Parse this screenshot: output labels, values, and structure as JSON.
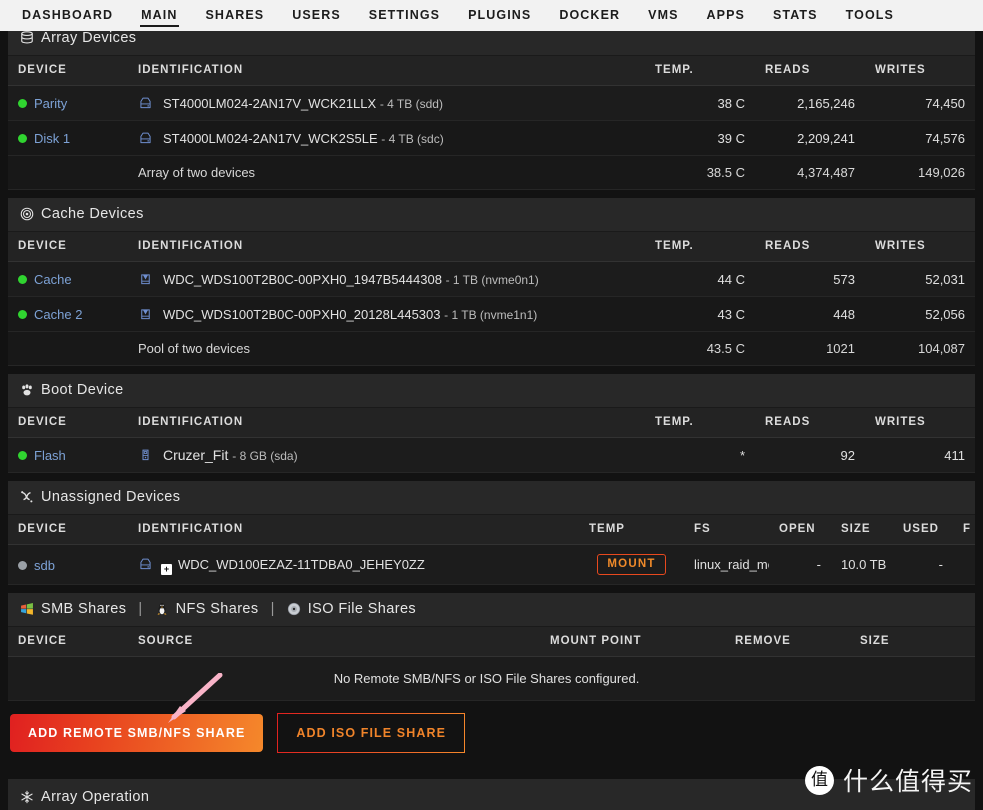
{
  "nav": {
    "items": [
      {
        "label": "DASHBOARD",
        "active": false
      },
      {
        "label": "MAIN",
        "active": true
      },
      {
        "label": "SHARES",
        "active": false
      },
      {
        "label": "USERS",
        "active": false
      },
      {
        "label": "SETTINGS",
        "active": false
      },
      {
        "label": "PLUGINS",
        "active": false
      },
      {
        "label": "DOCKER",
        "active": false
      },
      {
        "label": "VMS",
        "active": false
      },
      {
        "label": "APPS",
        "active": false
      },
      {
        "label": "STATS",
        "active": false
      },
      {
        "label": "TOOLS",
        "active": false
      }
    ]
  },
  "array_devices": {
    "title": "Array Devices",
    "icon": "database-stack-icon",
    "columns": [
      "DEVICE",
      "IDENTIFICATION",
      "TEMP.",
      "READS",
      "WRITES"
    ],
    "rows": [
      {
        "device": "Parity",
        "status_color": "#30d430",
        "icon": "hard-disk-icon",
        "identification": "ST4000LM024-2AN17V_WCK21LLX",
        "ident_suffix": "- 4 TB (sdd)",
        "temp": "38 C",
        "reads": "2,165,246",
        "writes": "74,450"
      },
      {
        "device": "Disk 1",
        "status_color": "#30d430",
        "icon": "hard-disk-icon",
        "identification": "ST4000LM024-2AN17V_WCK2S5LE",
        "ident_suffix": "- 4 TB (sdc)",
        "temp": "39 C",
        "reads": "2,209,241",
        "writes": "74,576"
      }
    ],
    "summary": {
      "label": "Array of two devices",
      "temp": "38.5 C",
      "reads": "4,374,487",
      "writes": "149,026"
    }
  },
  "cache_devices": {
    "title": "Cache Devices",
    "icon": "target-icon",
    "columns": [
      "DEVICE",
      "IDENTIFICATION",
      "TEMP.",
      "READS",
      "WRITES"
    ],
    "rows": [
      {
        "device": "Cache",
        "status_color": "#30d430",
        "icon": "ssd-icon",
        "identification": "WDC_WDS100T2B0C-00PXH0_1947B5444308",
        "ident_suffix": "- 1 TB (nvme0n1)",
        "temp": "44 C",
        "reads": "573",
        "writes": "52,031"
      },
      {
        "device": "Cache 2",
        "status_color": "#30d430",
        "icon": "ssd-icon",
        "identification": "WDC_WDS100T2B0C-00PXH0_20128L445303",
        "ident_suffix": "- 1 TB (nvme1n1)",
        "temp": "43 C",
        "reads": "448",
        "writes": "52,056"
      }
    ],
    "summary": {
      "label": "Pool of two devices",
      "temp": "43.5 C",
      "reads": "1021",
      "writes": "104,087"
    }
  },
  "boot_device": {
    "title": "Boot Device",
    "icon": "paw-print-icon",
    "columns": [
      "DEVICE",
      "IDENTIFICATION",
      "TEMP.",
      "READS",
      "WRITES"
    ],
    "rows": [
      {
        "device": "Flash",
        "status_color": "#30d430",
        "icon": "usb-flash-icon",
        "identification": "Cruzer_Fit",
        "ident_suffix": "- 8 GB (sda)",
        "temp": "*",
        "reads": "92",
        "writes": "411"
      }
    ]
  },
  "unassigned_devices": {
    "title": "Unassigned Devices",
    "icon": "scatter-icon",
    "columns": [
      "DEVICE",
      "IDENTIFICATION",
      "TEMP",
      "FS",
      "OPEN",
      "SIZE",
      "USED",
      "F"
    ],
    "rows": [
      {
        "device": "sdb",
        "status_color": "#9aa0a6",
        "icon": "hard-disk-icon",
        "expander": "+",
        "identification": "WDC_WD100EZAZ-11TDBA0_JEHEY0ZZ",
        "mount_label": "MOUNT",
        "fs": "linux_raid_member",
        "open": "-",
        "size": "10.0 TB",
        "used": "-"
      }
    ]
  },
  "shares": {
    "smb_label": "SMB Shares",
    "smb_icon": "windows-logo-icon",
    "nfs_label": "NFS Shares",
    "nfs_icon": "tux-penguin-icon",
    "iso_label": "ISO File Shares",
    "iso_icon": "compact-disc-icon",
    "separator": "|",
    "columns": [
      "DEVICE",
      "SOURCE",
      "MOUNT POINT",
      "REMOVE",
      "SIZE"
    ],
    "empty_message": "No Remote SMB/NFS or ISO File Shares configured.",
    "add_remote_button": "ADD REMOTE SMB/NFS SHARE",
    "add_iso_button": "ADD ISO FILE SHARE",
    "primary_color_start": "#e02020",
    "primary_color_end": "#f5882b"
  },
  "array_operation": {
    "title": "Array Operation",
    "icon": "snowflake-icon"
  },
  "watermark": {
    "badge": "值",
    "text": "什么值得买"
  },
  "annotation": {
    "arrow_color": "#f9b4c8"
  }
}
